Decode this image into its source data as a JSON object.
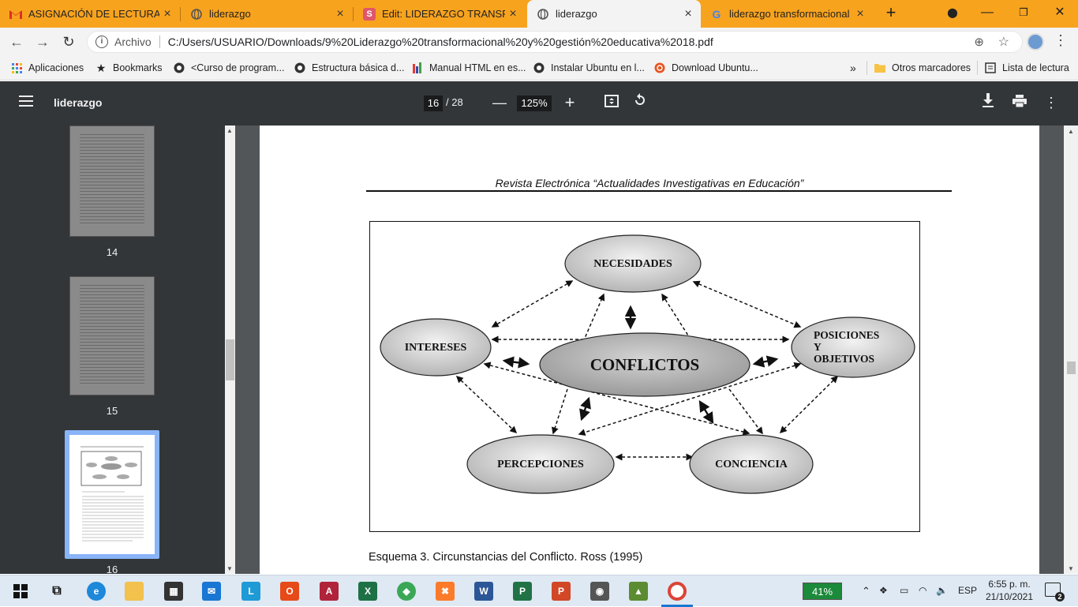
{
  "tabs": [
    {
      "title": "ASIGNACIÓN DE LECTURAS S",
      "icon": "gmail-icon",
      "color": "#d93025"
    },
    {
      "title": "liderazgo",
      "icon": "globe-icon",
      "color": "#555"
    },
    {
      "title": "Edit: LIDERAZGO TRANSFORM",
      "icon": "scribd-icon",
      "color": "#e0566b",
      "letter": "S"
    },
    {
      "title": "liderazgo",
      "icon": "globe-icon",
      "color": "#555"
    },
    {
      "title": "liderazgo transformacional - ",
      "icon": "google-icon",
      "color": "#4285f4",
      "letter": "G"
    }
  ],
  "address": {
    "origin": "Archivo",
    "url": "C:/Users/USUARIO/Downloads/9%20Liderazgo%20transformacional%20y%20gestión%20educativa%2018.pdf"
  },
  "bookmarks": [
    {
      "label": "Aplicaciones",
      "icon": "apps-grid-icon"
    },
    {
      "label": "Bookmarks",
      "icon": "star-icon"
    },
    {
      "label": "<Curso de program...",
      "icon": "globe-icon"
    },
    {
      "label": "Estructura básica d...",
      "icon": "globe-icon"
    },
    {
      "label": "Manual HTML en es...",
      "icon": "bars-icon"
    },
    {
      "label": "Instalar Ubuntu en l...",
      "icon": "globe-icon"
    },
    {
      "label": "Download Ubuntu...",
      "icon": "ubuntu-icon"
    }
  ],
  "bookmarks_right": {
    "more": "»",
    "other": "Otros marcadores",
    "reading": "Lista de lectura"
  },
  "pdf": {
    "title": "liderazgo",
    "page": "16",
    "total": "/ 28",
    "zoom": "125%"
  },
  "thumbnails": [
    {
      "label": "14"
    },
    {
      "label": "15"
    },
    {
      "label": "16"
    }
  ],
  "document": {
    "journal": "Revista Electrónica “Actualidades Investigativas en Educación”",
    "caption": "Esquema 3. Circunstancias del Conflicto. Ross (1995)",
    "nodes": {
      "center": "CONFLICTOS",
      "top": "NECESIDADES",
      "left": "INTERESES",
      "right_line1": "POSICIONES",
      "right_line2": "Y",
      "right_line3": "OBJETIVOS",
      "bottom_left": "PERCEPCIONES",
      "bottom_right": "CONCIENCIA"
    }
  },
  "taskbar": {
    "battery": "41%",
    "lang": "ESP",
    "time": "6:55 p. m.",
    "date": "21/10/2021",
    "notifications": "2"
  }
}
